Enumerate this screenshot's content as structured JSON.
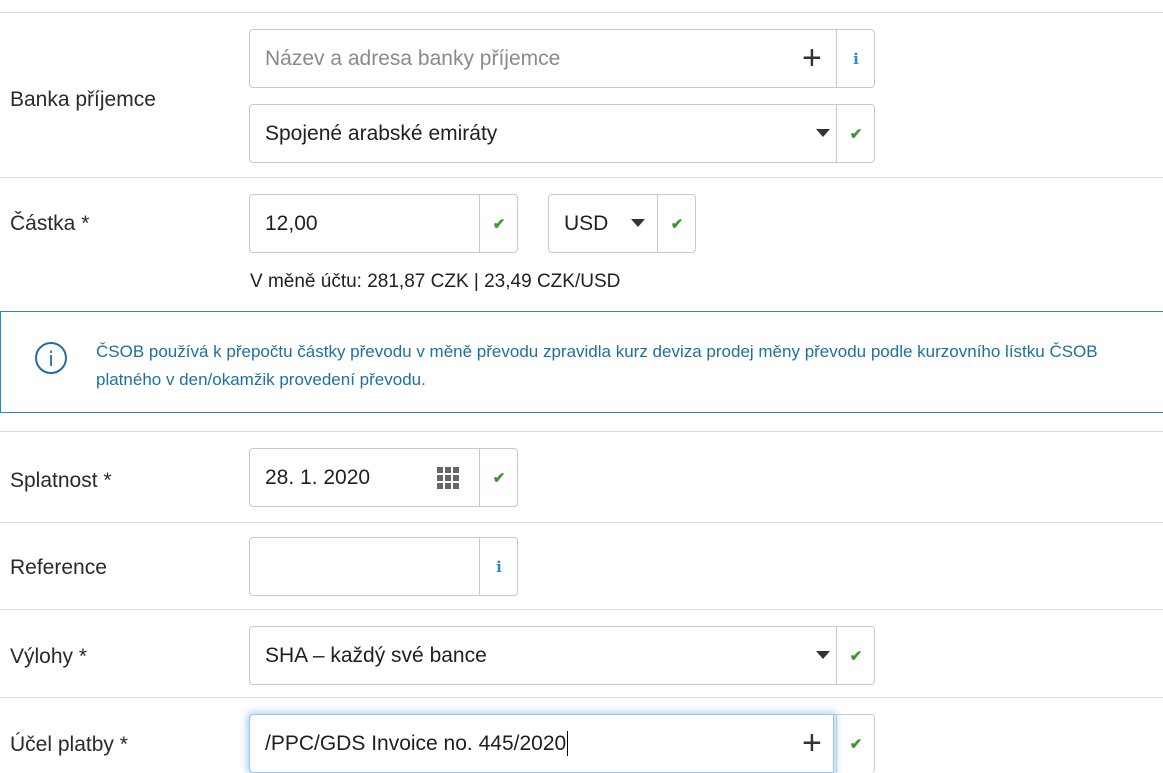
{
  "bank": {
    "label": "Banka příjemce",
    "name_placeholder": "Název a adresa banky příjemce",
    "country_value": "Spojené arabské emiráty"
  },
  "amount": {
    "label": "Částka *",
    "value": "12,00",
    "currency": "USD",
    "account_currency_text": "V měně účtu: 281,87 CZK | 23,49 CZK/USD"
  },
  "notice": {
    "text": "ČSOB používá k přepočtu částky převodu v měně převodu zpravidla kurz deviza prodej měny převodu podle kurzovního lístku ČSOB platného v den/okamžik provedení převodu."
  },
  "due": {
    "label": "Splatnost *",
    "value": "28. 1. 2020"
  },
  "reference": {
    "label": "Reference",
    "value": ""
  },
  "fees": {
    "label": "Výlohy *",
    "value": "SHA – každý své bance"
  },
  "purpose": {
    "label": "Účel platby *",
    "value": "/PPC/GDS Invoice no. 445/2020"
  },
  "icons": {
    "info": "i",
    "check": "✔",
    "plus": "+",
    "notice_info": "i"
  },
  "colors": {
    "check_green": "#3a9a2c",
    "info_blue": "#2d8bd0",
    "notice_border": "#2b86bd",
    "notice_text": "#1f6f9f"
  }
}
